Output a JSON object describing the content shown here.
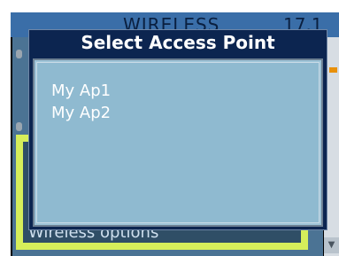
{
  "background": {
    "title": "WIRELESS",
    "version": "17.1",
    "section_label": "Wireless options",
    "scroll_down_glyph": "▼"
  },
  "dialog": {
    "title": "Select Access Point",
    "items": [
      {
        "label": "My Ap1"
      },
      {
        "label": "My Ap2"
      }
    ]
  },
  "colors": {
    "dialog_bg": "#0c2550",
    "list_bg": "#8fbad0",
    "accent_green": "#d6ee5a"
  }
}
